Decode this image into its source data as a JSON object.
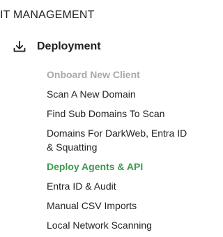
{
  "section": {
    "title": "IT MANAGEMENT"
  },
  "group": {
    "label": "Deployment",
    "icon": "download-icon"
  },
  "menu": {
    "items": [
      {
        "label": "Onboard New Client",
        "state": "disabled"
      },
      {
        "label": "Scan A New Domain",
        "state": "normal"
      },
      {
        "label": "Find Sub Domains To Scan",
        "state": "normal"
      },
      {
        "label": "Domains For DarkWeb, Entra ID & Squatting",
        "state": "normal"
      },
      {
        "label": "Deploy Agents & API",
        "state": "active"
      },
      {
        "label": "Entra ID & Audit",
        "state": "normal"
      },
      {
        "label": "Manual CSV Imports",
        "state": "normal"
      },
      {
        "label": "Local Network Scanning",
        "state": "normal"
      }
    ]
  },
  "colors": {
    "active": "#3d9a4f",
    "disabled": "#a9a9a9",
    "text": "#222222"
  }
}
